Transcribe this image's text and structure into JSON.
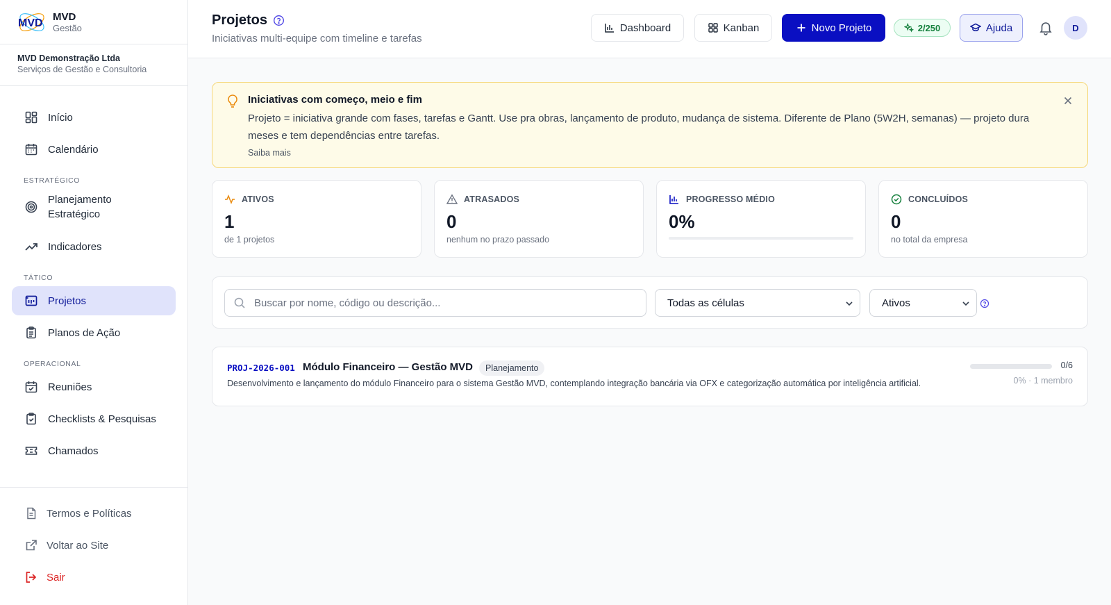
{
  "brand": {
    "name": "MVD",
    "sub": "Gestão",
    "logo_text": "MVD"
  },
  "company": {
    "name": "MVD Demonstração Ltda",
    "tagline": "Serviços de Gestão e Consultoria"
  },
  "sidebar": {
    "items": [
      {
        "label": "Início",
        "icon": "grid-icon"
      },
      {
        "label": "Calendário",
        "icon": "calendar-icon"
      }
    ],
    "sections": [
      {
        "title": "ESTRATÉGICO",
        "items": [
          {
            "label_line1": "Planejamento",
            "label_line2": "Estratégico",
            "icon": "target-icon"
          },
          {
            "label": "Indicadores",
            "icon": "trending-up-icon"
          }
        ]
      },
      {
        "title": "TÁTICO",
        "items": [
          {
            "label": "Projetos",
            "icon": "projects-icon",
            "active": true
          },
          {
            "label": "Planos de Ação",
            "icon": "clipboard-icon"
          }
        ]
      },
      {
        "title": "OPERACIONAL",
        "items": [
          {
            "label": "Reuniões",
            "icon": "calendar-check-icon"
          },
          {
            "label": "Checklists & Pesquisas",
            "icon": "clipboard-check-icon"
          },
          {
            "label": "Chamados",
            "icon": "ticket-icon"
          }
        ]
      }
    ],
    "bottom": [
      {
        "label": "Termos e Políticas",
        "icon": "document-icon"
      },
      {
        "label": "Voltar ao Site",
        "icon": "external-link-icon"
      },
      {
        "label": "Sair",
        "icon": "logout-icon"
      }
    ]
  },
  "header": {
    "title": "Projetos",
    "subtitle": "Iniciativas multi-equipe com timeline e tarefas",
    "dashboard_label": "Dashboard",
    "kanban_label": "Kanban",
    "new_project_label": "Novo Projeto",
    "quota": "2/250",
    "help_label": "Ajuda",
    "avatar_initial": "D"
  },
  "alert": {
    "title": "Iniciativas com começo, meio e fim",
    "description": "Projeto = iniciativa grande com fases, tarefas e Gantt. Use pra obras, lançamento de produto, mudança de sistema. Diferente de Plano (5W2H, semanas) — projeto dura meses e tem dependências entre tarefas.",
    "more_label": "Saiba mais"
  },
  "stats": {
    "active": {
      "label": "ATIVOS",
      "value": "1",
      "sub": "de 1 projetos"
    },
    "late": {
      "label": "ATRASADOS",
      "value": "0",
      "sub": "nenhum no prazo passado"
    },
    "progress": {
      "label": "PROGRESSO MÉDIO",
      "value": "0%",
      "fraction": 0
    },
    "done": {
      "label": "CONCLUÍDOS",
      "value": "0",
      "sub": "no total da empresa"
    }
  },
  "filters": {
    "search_placeholder": "Buscar por nome, código ou descrição...",
    "cells_selected": "Todas as células",
    "status_selected": "Ativos"
  },
  "projects": [
    {
      "code": "PROJ-2026-001",
      "name": "Módulo Financeiro — Gestão MVD",
      "status": "Planejamento",
      "description": "Desenvolvimento e lançamento do módulo Financeiro para o sistema Gestão MVD, contemplando integração bancária via OFX e categorização automática por inteligência artificial.",
      "tasks": "0/6",
      "meta": "0% · 1 membro",
      "progress_fraction": 0
    }
  ],
  "colors": {
    "primary": "#0a0fc2",
    "active_bg": "#e0e3fb",
    "alert_bg": "#fefbe8",
    "danger": "#dc2626"
  }
}
